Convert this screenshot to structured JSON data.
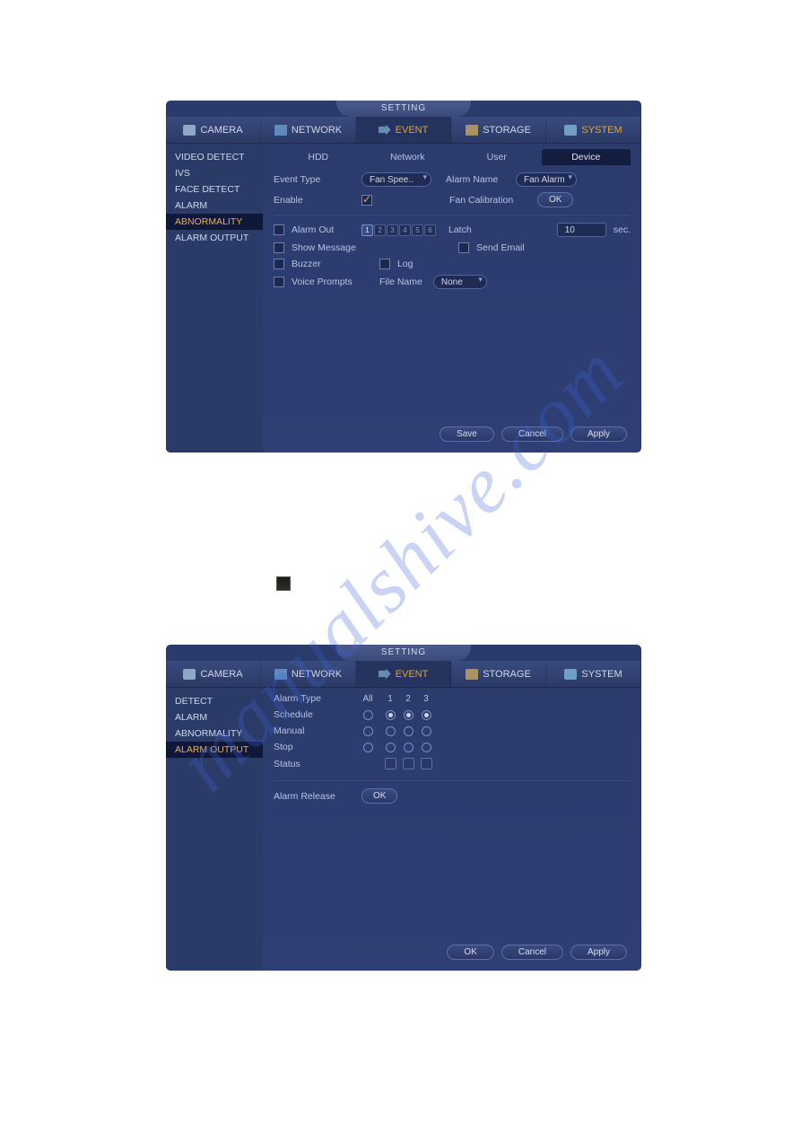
{
  "watermark": "manualshive.com",
  "screenshot1": {
    "title": "SETTING",
    "menu": {
      "items": [
        {
          "label": "CAMERA"
        },
        {
          "label": "NETWORK"
        },
        {
          "label": "EVENT"
        },
        {
          "label": "STORAGE"
        },
        {
          "label": "SYSTEM"
        }
      ],
      "active_index": 2
    },
    "sidebar": {
      "items": [
        "VIDEO DETECT",
        "IVS",
        "FACE DETECT",
        "ALARM",
        "ABNORMALITY",
        "ALARM OUTPUT"
      ],
      "active_index": 4
    },
    "subtabs": {
      "items": [
        "HDD",
        "Network",
        "User",
        "Device"
      ],
      "active_index": 3
    },
    "form": {
      "event_type_label": "Event Type",
      "event_type_value": "Fan Spee..",
      "alarm_name_label": "Alarm Name",
      "alarm_name_value": "Fan Alarm",
      "enable_label": "Enable",
      "enable_checked": true,
      "fan_cal_label": "Fan Calibration",
      "fan_cal_button": "OK",
      "alarm_out_label": "Alarm Out",
      "alarm_out_channels": [
        "1",
        "2",
        "3",
        "4",
        "5",
        "6"
      ],
      "alarm_out_selected": [
        0
      ],
      "latch_label": "Latch",
      "latch_value": "10",
      "latch_unit": "sec.",
      "show_message_label": "Show Message",
      "send_email_label": "Send Email",
      "buzzer_label": "Buzzer",
      "log_label": "Log",
      "voice_prompts_label": "Voice Prompts",
      "file_name_label": "File Name",
      "file_name_value": "None"
    },
    "buttons": {
      "save": "Save",
      "cancel": "Cancel",
      "apply": "Apply"
    }
  },
  "screenshot2": {
    "title": "SETTING",
    "menu": {
      "items": [
        {
          "label": "CAMERA"
        },
        {
          "label": "NETWORK"
        },
        {
          "label": "EVENT"
        },
        {
          "label": "STORAGE"
        },
        {
          "label": "SYSTEM"
        }
      ],
      "active_index": 2
    },
    "sidebar": {
      "items": [
        "DETECT",
        "ALARM",
        "ABNORMALITY",
        "ALARM OUTPUT"
      ],
      "active_index": 3
    },
    "alarm": {
      "type_label": "Alarm Type",
      "all_label": "All",
      "cols": [
        "1",
        "2",
        "3"
      ],
      "schedule_label": "Schedule",
      "manual_label": "Manual",
      "stop_label": "Stop",
      "status_label": "Status",
      "schedule_sel": [
        true,
        true,
        true
      ],
      "schedule_all": false,
      "manual_sel": [
        false,
        false,
        false
      ],
      "manual_all": false,
      "stop_sel": [
        false,
        false,
        false
      ],
      "stop_all": false,
      "release_label": "Alarm Release",
      "release_button": "OK"
    },
    "buttons": {
      "ok": "OK",
      "cancel": "Cancel",
      "apply": "Apply"
    }
  }
}
